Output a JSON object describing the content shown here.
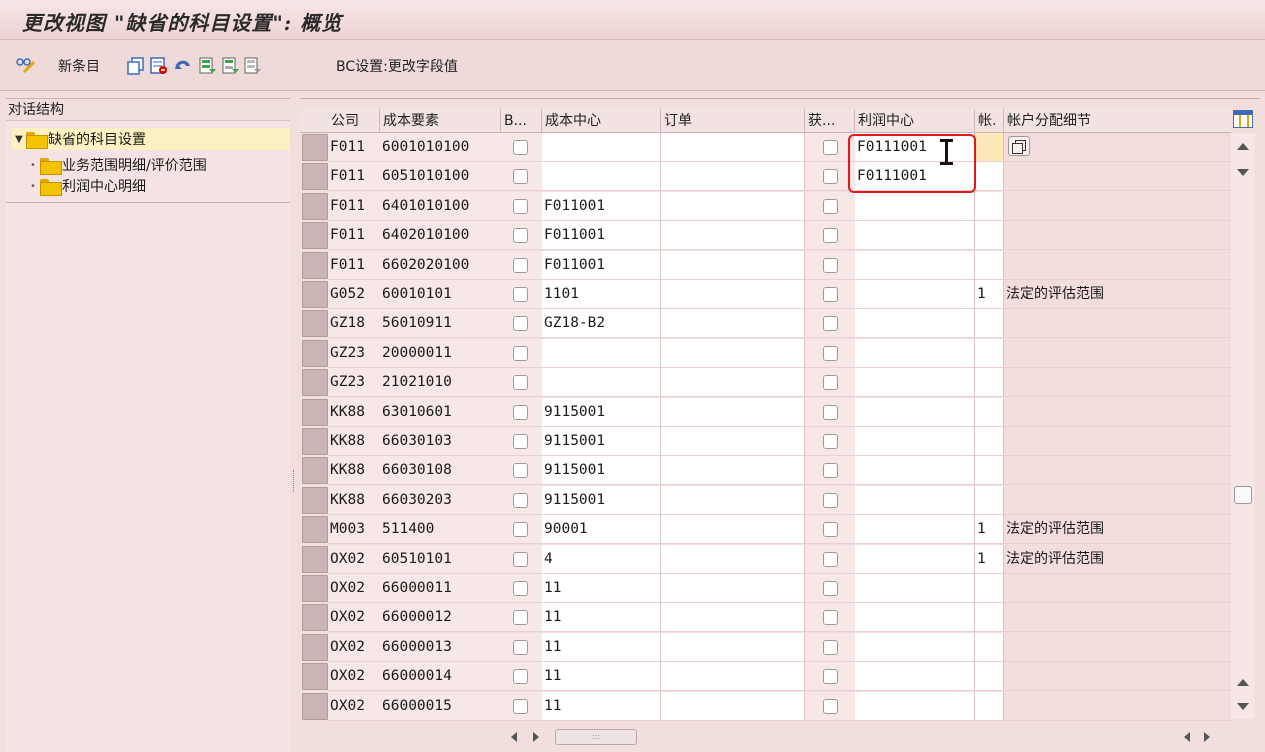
{
  "title": "更改视图 \"缺省的科目设置\": 概览",
  "toolbar": {
    "new_entries": "新条目",
    "bc_set": "BC设置:更改字段值"
  },
  "dialog_structure": {
    "title": "对话结构",
    "root": "缺省的科目设置",
    "children": [
      "业务范围明细/评价范围",
      "利润中心明细"
    ]
  },
  "table": {
    "columns": [
      "公司",
      "成本要素",
      "B...",
      "成本中心",
      "订单",
      "获...",
      "利润中心",
      "帐.",
      "帐户分配细节"
    ],
    "rows": [
      {
        "company": "F011",
        "cost_element": "6001010100",
        "cost_center": "",
        "profit_center": "F0111001",
        "acct": "",
        "detail": ""
      },
      {
        "company": "F011",
        "cost_element": "6051010100",
        "cost_center": "",
        "profit_center": "F0111001",
        "acct": "",
        "detail": ""
      },
      {
        "company": "F011",
        "cost_element": "6401010100",
        "cost_center": "F011001",
        "profit_center": "",
        "acct": "",
        "detail": ""
      },
      {
        "company": "F011",
        "cost_element": "6402010100",
        "cost_center": "F011001",
        "profit_center": "",
        "acct": "",
        "detail": ""
      },
      {
        "company": "F011",
        "cost_element": "6602020100",
        "cost_center": "F011001",
        "profit_center": "",
        "acct": "",
        "detail": ""
      },
      {
        "company": "G052",
        "cost_element": "60010101",
        "cost_center": "1101",
        "profit_center": "",
        "acct": "1",
        "detail": "法定的评估范围"
      },
      {
        "company": "GZ18",
        "cost_element": "56010911",
        "cost_center": "GZ18-B2",
        "profit_center": "",
        "acct": "",
        "detail": ""
      },
      {
        "company": "GZ23",
        "cost_element": "20000011",
        "cost_center": "",
        "profit_center": "",
        "acct": "",
        "detail": ""
      },
      {
        "company": "GZ23",
        "cost_element": "21021010",
        "cost_center": "",
        "profit_center": "",
        "acct": "",
        "detail": ""
      },
      {
        "company": "KK88",
        "cost_element": "63010601",
        "cost_center": "9115001",
        "profit_center": "",
        "acct": "",
        "detail": ""
      },
      {
        "company": "KK88",
        "cost_element": "66030103",
        "cost_center": "9115001",
        "profit_center": "",
        "acct": "",
        "detail": ""
      },
      {
        "company": "KK88",
        "cost_element": "66030108",
        "cost_center": "9115001",
        "profit_center": "",
        "acct": "",
        "detail": ""
      },
      {
        "company": "KK88",
        "cost_element": "66030203",
        "cost_center": "9115001",
        "profit_center": "",
        "acct": "",
        "detail": ""
      },
      {
        "company": "M003",
        "cost_element": "511400",
        "cost_center": "90001",
        "profit_center": "",
        "acct": "1",
        "detail": "法定的评估范围"
      },
      {
        "company": "OX02",
        "cost_element": "60510101",
        "cost_center": "4",
        "profit_center": "",
        "acct": "1",
        "detail": "法定的评估范围"
      },
      {
        "company": "OX02",
        "cost_element": "66000011",
        "cost_center": "11",
        "profit_center": "",
        "acct": "",
        "detail": ""
      },
      {
        "company": "OX02",
        "cost_element": "66000012",
        "cost_center": "11",
        "profit_center": "",
        "acct": "",
        "detail": ""
      },
      {
        "company": "OX02",
        "cost_element": "66000013",
        "cost_center": "11",
        "profit_center": "",
        "acct": "",
        "detail": ""
      },
      {
        "company": "OX02",
        "cost_element": "66000014",
        "cost_center": "11",
        "profit_center": "",
        "acct": "",
        "detail": ""
      },
      {
        "company": "OX02",
        "cost_element": "66000015",
        "cost_center": "11",
        "profit_center": "",
        "acct": "",
        "detail": ""
      }
    ]
  },
  "colors": {
    "background": "#f3dede",
    "highlight_box": "#e3171c",
    "selected_tree": "#fdf0c2",
    "folder": "#f3c200"
  }
}
